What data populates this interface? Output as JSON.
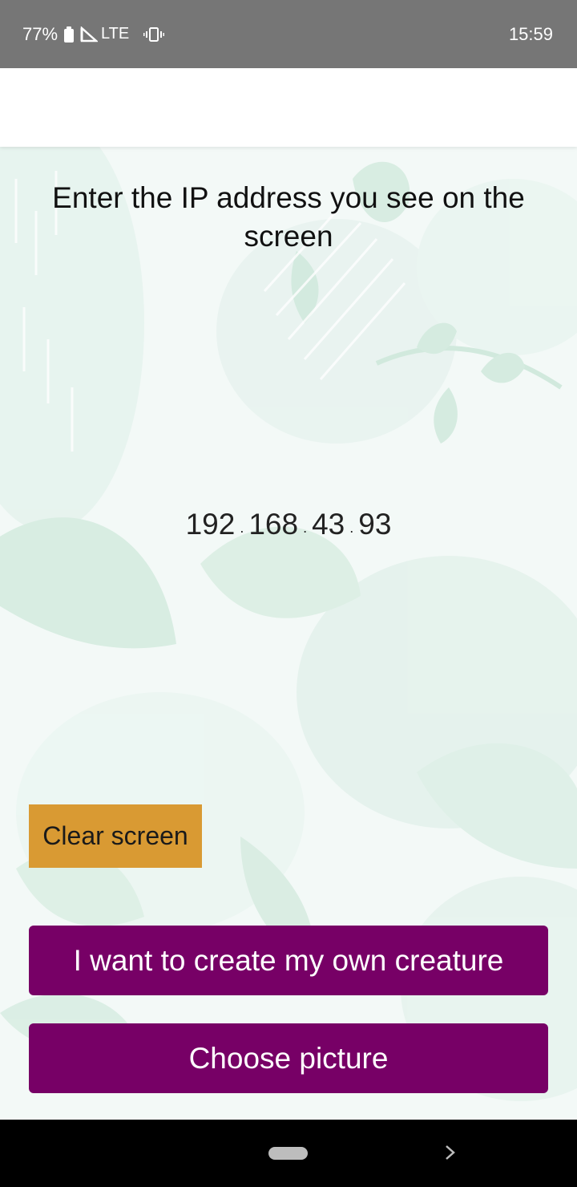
{
  "status_bar": {
    "battery": "77%",
    "network": "LTE",
    "time": "15:59"
  },
  "main": {
    "instruction": "Enter the IP address you see on the screen",
    "ip": {
      "octet1": "192",
      "octet2": "168",
      "octet3": "43",
      "octet4": "93",
      "separator": "."
    }
  },
  "buttons": {
    "clear": "Clear screen",
    "create": "I want to create my own creature",
    "choose": "Choose picture"
  },
  "colors": {
    "status_bar": "#767676",
    "clear_button": "#d99a33",
    "primary_button": "#770066",
    "background_leaf": "#cfe9dc"
  },
  "icons": [
    "battery-icon",
    "signal-icon",
    "vibrate-icon",
    "home-pill-icon",
    "back-chevron-icon"
  ]
}
